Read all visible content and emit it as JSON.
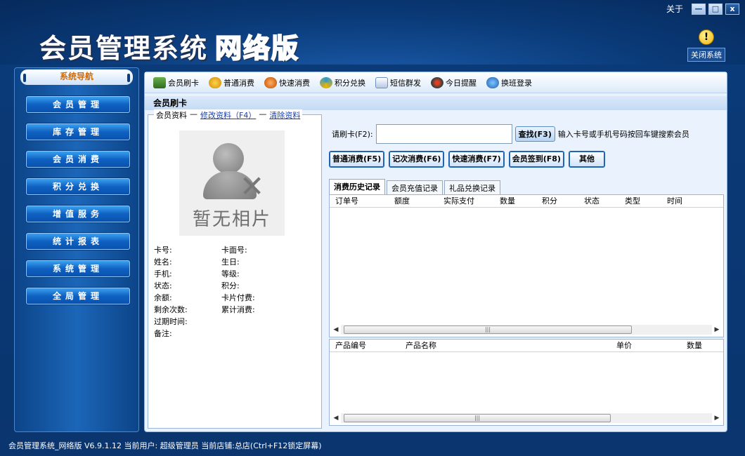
{
  "window": {
    "about": "关于",
    "min": "—",
    "max": "□",
    "close": "x",
    "shutdown": "关闭系统"
  },
  "logo": {
    "main": "会员管理系统",
    "sub": "网络版"
  },
  "nav": {
    "header": "系统导航",
    "items": [
      "会员管理",
      "库存管理",
      "会员消费",
      "积分兑换",
      "增值服务",
      "统计报表",
      "系统管理",
      "全局管理"
    ]
  },
  "toolbar": {
    "items": [
      {
        "label": "会员刷卡",
        "icon": "card-reader-icon",
        "color": "#3a7a2a"
      },
      {
        "label": "普通消费",
        "icon": "money-bag-icon",
        "color": "#e0a020"
      },
      {
        "label": "快速消费",
        "icon": "rocket-icon",
        "color": "#d06010"
      },
      {
        "label": "积分兑换",
        "icon": "refresh-icon",
        "color": "#2a9ad0"
      },
      {
        "label": "短信群发",
        "icon": "envelope-icon",
        "color": "#7090c0"
      },
      {
        "label": "今日提醒",
        "icon": "clock-icon",
        "color": "#404040"
      },
      {
        "label": "换班登录",
        "icon": "login-icon",
        "color": "#1c7ad0"
      }
    ]
  },
  "page": {
    "title": "会员刷卡"
  },
  "member": {
    "legend": "会员资料",
    "edit_link": "修改资料（F4）",
    "clear_link": "清除资料",
    "no_photo": "暂无相片",
    "fields": [
      [
        "卡号:",
        "卡面号:"
      ],
      [
        "姓名:",
        "生日:"
      ],
      [
        "手机:",
        "等级:"
      ],
      [
        "状态:",
        "积分:"
      ],
      [
        "余额:",
        "卡片付费:"
      ],
      [
        "剩余次数:",
        "累计消费:"
      ],
      [
        "过期时间:",
        ""
      ],
      [
        "备注:",
        ""
      ]
    ]
  },
  "search": {
    "label": "请刷卡(F2):",
    "value": "",
    "button": "查找(F3)",
    "hint": "输入卡号或手机号码按回车键搜索会员"
  },
  "actions": [
    "普通消费(F5)",
    "记次消费(F6)",
    "快速消费(F7)",
    "会员签到(F8)",
    "其他"
  ],
  "tabs": [
    "消费历史记录",
    "会员充值记录",
    "礼品兑换记录"
  ],
  "grid1": {
    "columns": [
      "订单号",
      "额度",
      "实际支付",
      "数量",
      "积分",
      "状态",
      "类型",
      "时间"
    ]
  },
  "grid2": {
    "columns": [
      "产品编号",
      "产品名称",
      "单价",
      "数量"
    ]
  },
  "status": "会员管理系统_网络版 V6.9.1.12 当前用户: 超级管理员 当前店铺:总店(Ctrl+F12锁定屏幕)"
}
